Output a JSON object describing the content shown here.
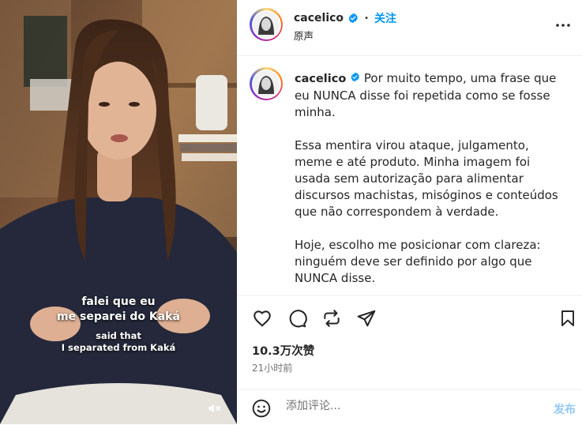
{
  "media": {
    "subtitle_pt": [
      "falei que eu",
      "me separei do Kaká"
    ],
    "subtitle_en": [
      "said that",
      "I separated from Kaká"
    ],
    "mute_icon": "speaker-muted-icon"
  },
  "header": {
    "username": "cacelico",
    "separator": "•",
    "follow_label": "关注",
    "audio_label": "原声",
    "more_icon": "more-options-icon"
  },
  "caption": {
    "username": "cacelico",
    "paragraphs": [
      "Por muito tempo, uma frase que eu NUNCA disse foi repetida como se fosse minha.",
      "Essa mentira virou ataque, julgamento, meme e até produto. Minha imagem foi usada sem autorização para alimentar discursos machistas, misóginos e conteúdos que não correspondem à verdade.",
      "Hoje, escolho me posicionar com clareza: ninguém deve ser definido por algo que NUNCA disse."
    ]
  },
  "actions": {
    "icons": [
      "heart-icon",
      "comment-icon",
      "repost-icon",
      "share-icon",
      "bookmark-icon"
    ]
  },
  "stats": {
    "likes": "10.3万次赞",
    "time_ago": "21小时前"
  },
  "comment": {
    "placeholder": "添加评论...",
    "post_label": "发布"
  },
  "colors": {
    "accent": "#0095f6",
    "post_disabled": "#93c8f6",
    "verified": "#0095f6"
  }
}
